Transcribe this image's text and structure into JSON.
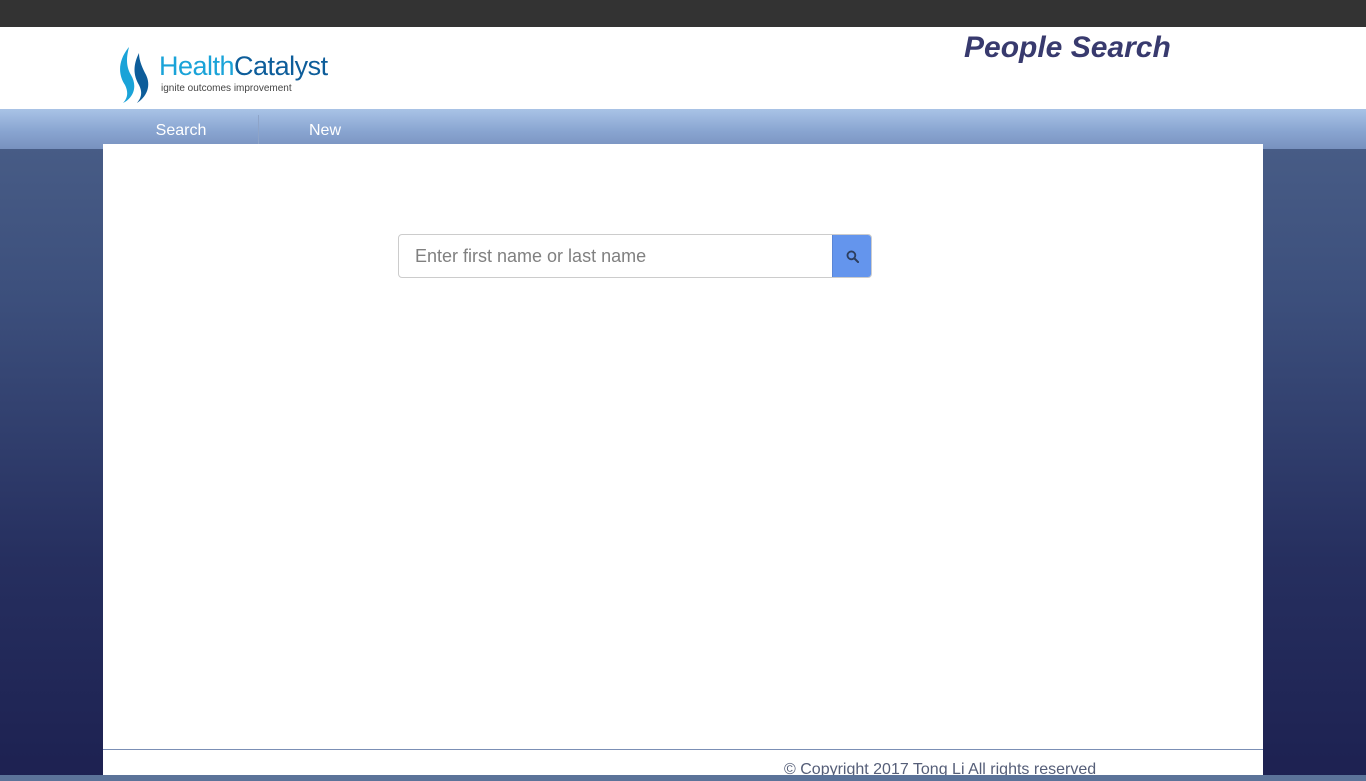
{
  "header": {
    "logo": {
      "name_part1": "Health",
      "name_part2": "Catalyst",
      "tagline": "ignite outcomes improvement"
    },
    "title": "People Search"
  },
  "nav": {
    "items": [
      {
        "label": "Search"
      },
      {
        "label": "New"
      }
    ]
  },
  "search": {
    "placeholder": "Enter first name or last name",
    "value": "",
    "button_icon": "search-icon"
  },
  "footer": {
    "copyright": "© Copyright 2017 Tong Li All rights reserved"
  },
  "colors": {
    "accent": "#6495ed",
    "title": "#383a6e",
    "topbar": "#333333"
  }
}
